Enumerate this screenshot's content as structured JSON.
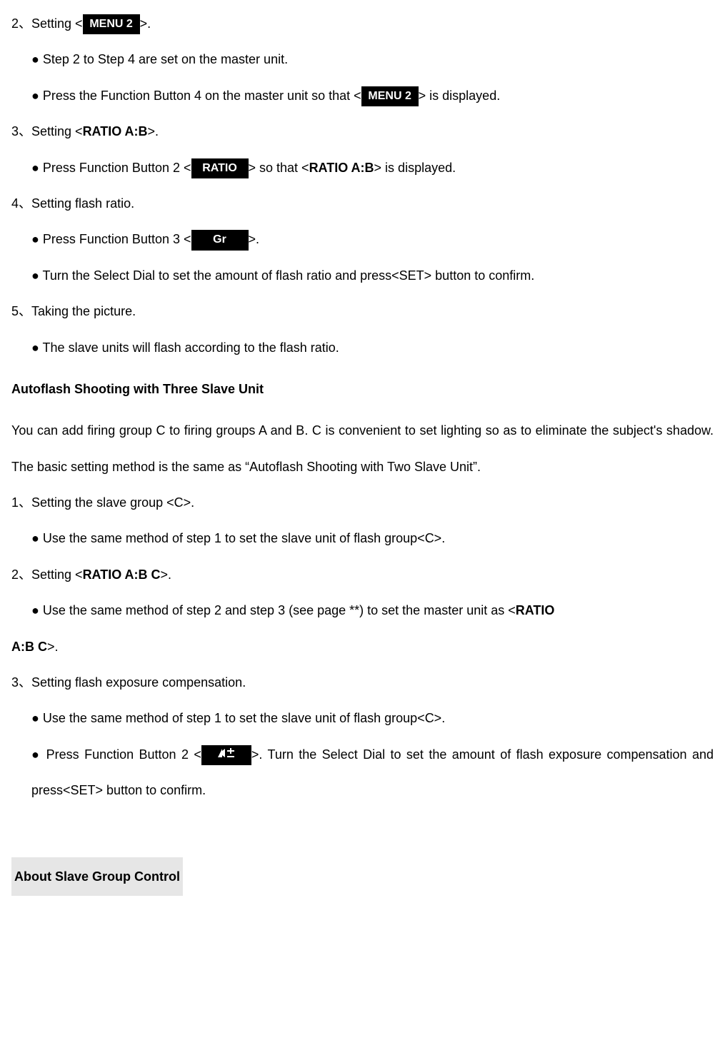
{
  "step2": {
    "line": {
      "pre": "2、Setting <",
      "btn": "MENU 2",
      "post": ">."
    },
    "b1": "● Step 2 to Step 4 are set on the master unit.",
    "b2": {
      "pre": "● Press the Function Button 4 on the master unit so that <",
      "btn": "MENU 2",
      "post": "> is displayed."
    }
  },
  "step3": {
    "line": {
      "pre": "3、Setting <",
      "bold": "RATIO A:B",
      "post": ">."
    },
    "b1": {
      "pre": "● Press Function Button 2 <",
      "btn": "RATIO",
      "mid": "> so that <",
      "bold": "RATIO A:B",
      "post": "> is displayed."
    }
  },
  "step4": {
    "line": "4、Setting flash ratio.",
    "b1": {
      "pre": "● Press Function Button 3 <",
      "btn": "Gr",
      "post": ">."
    },
    "b2": "● Turn the Select Dial to set the amount of flash ratio and press<SET> button to confirm."
  },
  "step5": {
    "line": "5、Taking the picture.",
    "b1": "● The slave units will flash according to the flash ratio."
  },
  "heading1": "Autoflash Shooting with Three Slave Unit",
  "intro": "You can add firing group C to firing groups A and B. C is convenient to set lighting so as to eliminate the subject's shadow. The basic setting method is the same as “Autoflash Shooting with Two Slave Unit”.",
  "cstep1": {
    "line": "1、Setting the slave group <C>.",
    "b1": "● Use the same method of step 1 to set the slave unit of flash group<C>."
  },
  "cstep2": {
    "line": {
      "pre": "2、Setting <",
      "bold": "RATIO A:B C",
      "post": ">."
    },
    "b1": {
      "pre": "● Use the same method of step 2 and step 3 (see page **) to set the master unit as <",
      "bold1": "RATIO",
      "bold2": "A:B C",
      "post": ">."
    }
  },
  "cstep3": {
    "line": "3、Setting flash exposure compensation.",
    "b1": "● Use the same method of step 1   to set the slave unit of flash group<C>.",
    "b2": {
      "pre": "● Press Function Button 2 <",
      "post": ">. Turn the Select Dial to set the amount of flash exposure compensation and press<SET> button to confirm."
    }
  },
  "heading2": "About Slave Group Control"
}
